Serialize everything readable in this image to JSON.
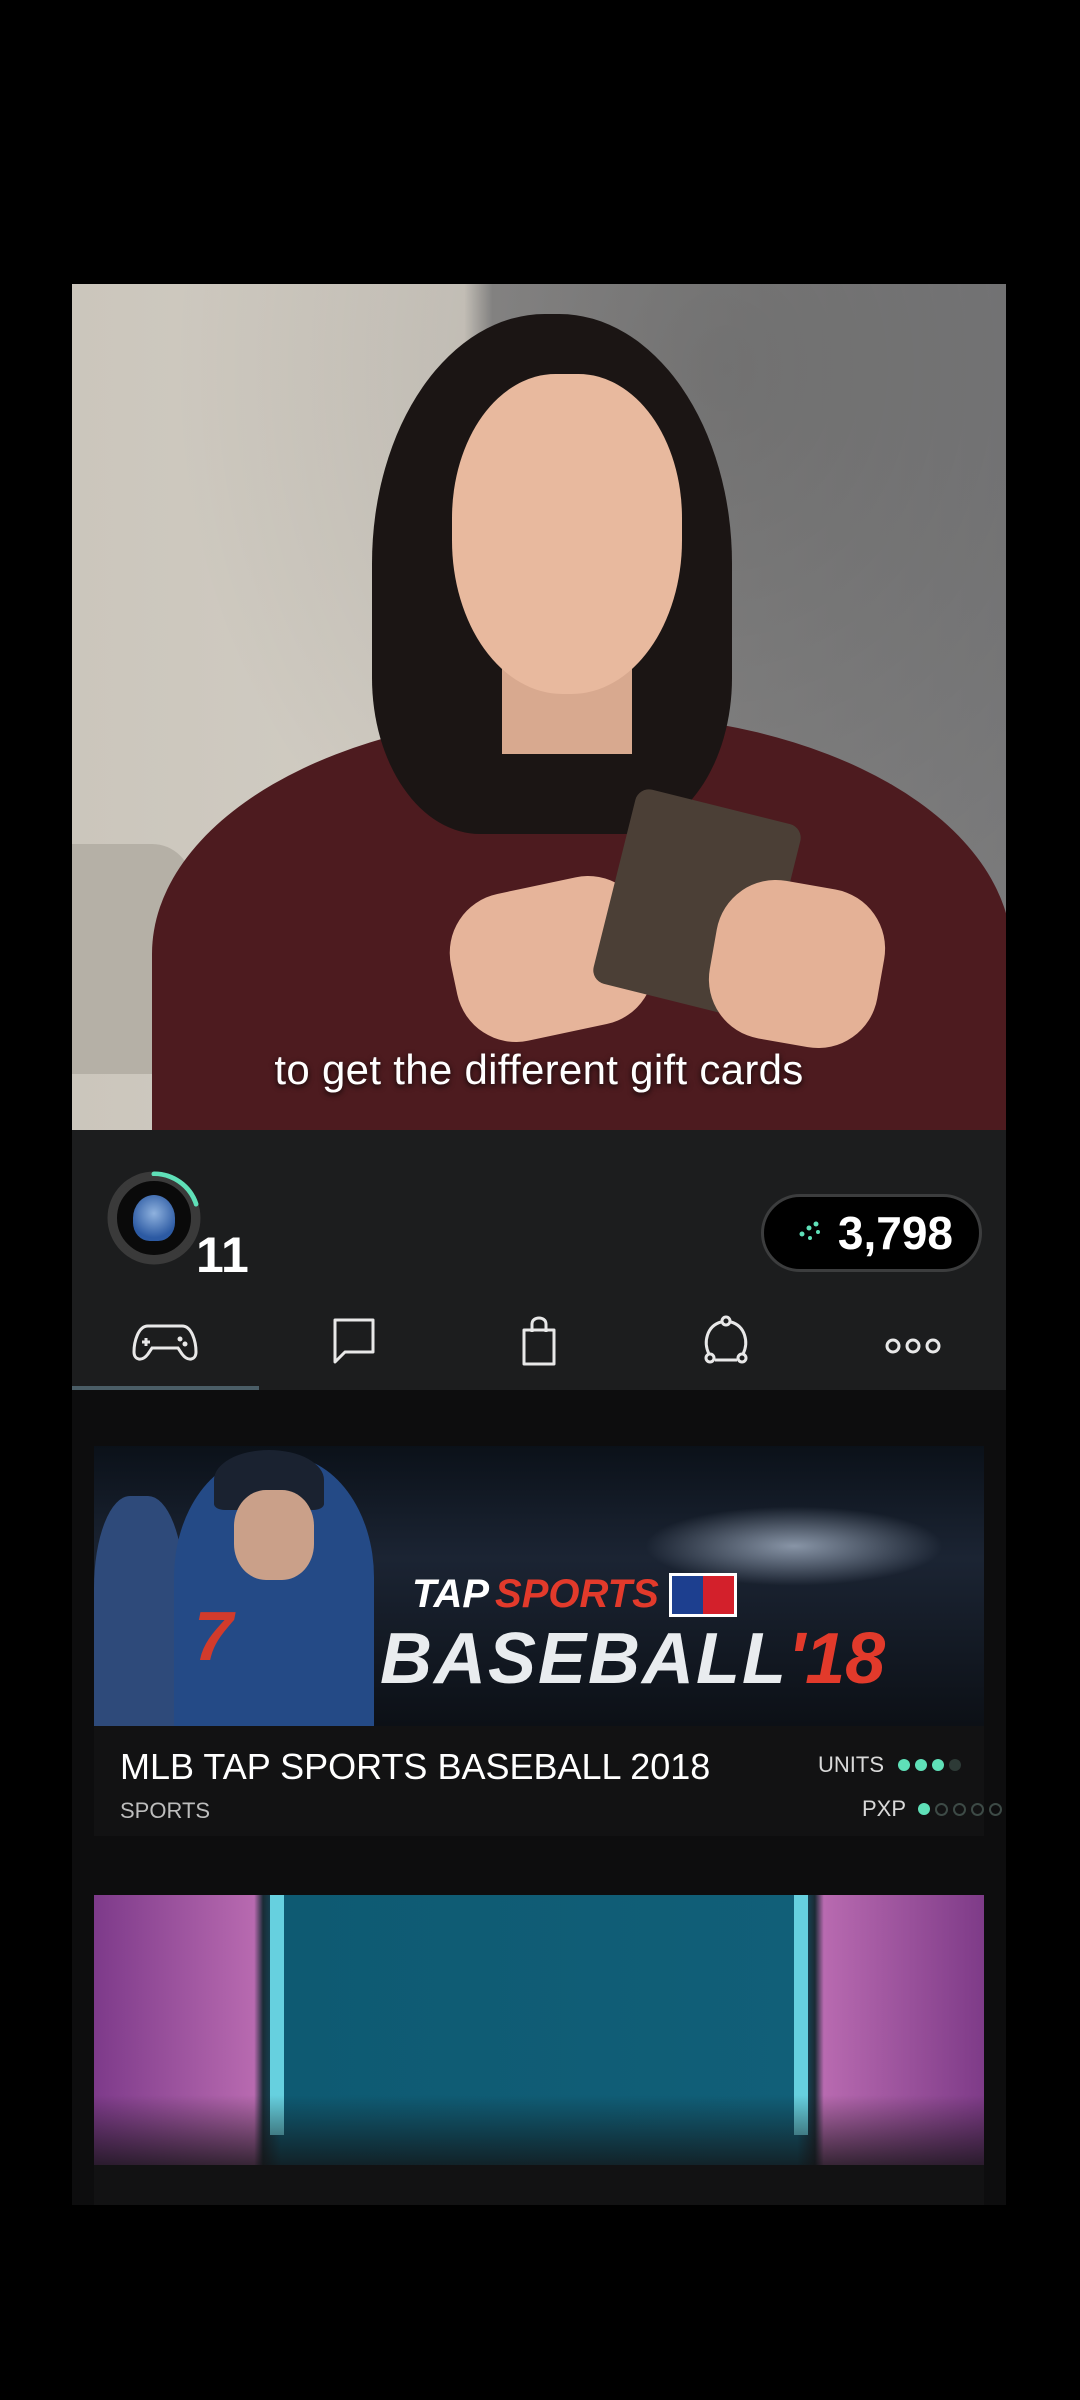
{
  "video": {
    "subtitle": "to get the different gift cards"
  },
  "header": {
    "level": "11",
    "points": "3,798",
    "avatar_icon": "avatar-icon",
    "points_icon": "sparkle-icon",
    "progress_color": "#5fe0b8"
  },
  "tabs": [
    {
      "name": "games",
      "icon": "gamepad-icon",
      "active": true
    },
    {
      "name": "chat",
      "icon": "chat-bubble-icon",
      "active": false
    },
    {
      "name": "shop",
      "icon": "shopping-bag-icon",
      "active": false
    },
    {
      "name": "share",
      "icon": "share-icon",
      "active": false
    },
    {
      "name": "more",
      "icon": "more-dots-icon",
      "active": false
    }
  ],
  "games": [
    {
      "logo_tap": "TAP",
      "logo_sports": "SPORTS",
      "logo_baseball": "BASEBALL",
      "logo_year": "'18",
      "jersey_number": "7",
      "title": "MLB TAP SPORTS BASEBALL 2018",
      "category": "SPORTS",
      "units_label": "UNITS",
      "units_level": 3,
      "units_max": 4,
      "pxp_label": "PXP",
      "pxp_level": 1,
      "pxp_max": 5
    }
  ],
  "colors": {
    "accent": "#5fe0b8",
    "logo_red": "#e23a2b",
    "panel_bg": "#1c1d1e"
  }
}
